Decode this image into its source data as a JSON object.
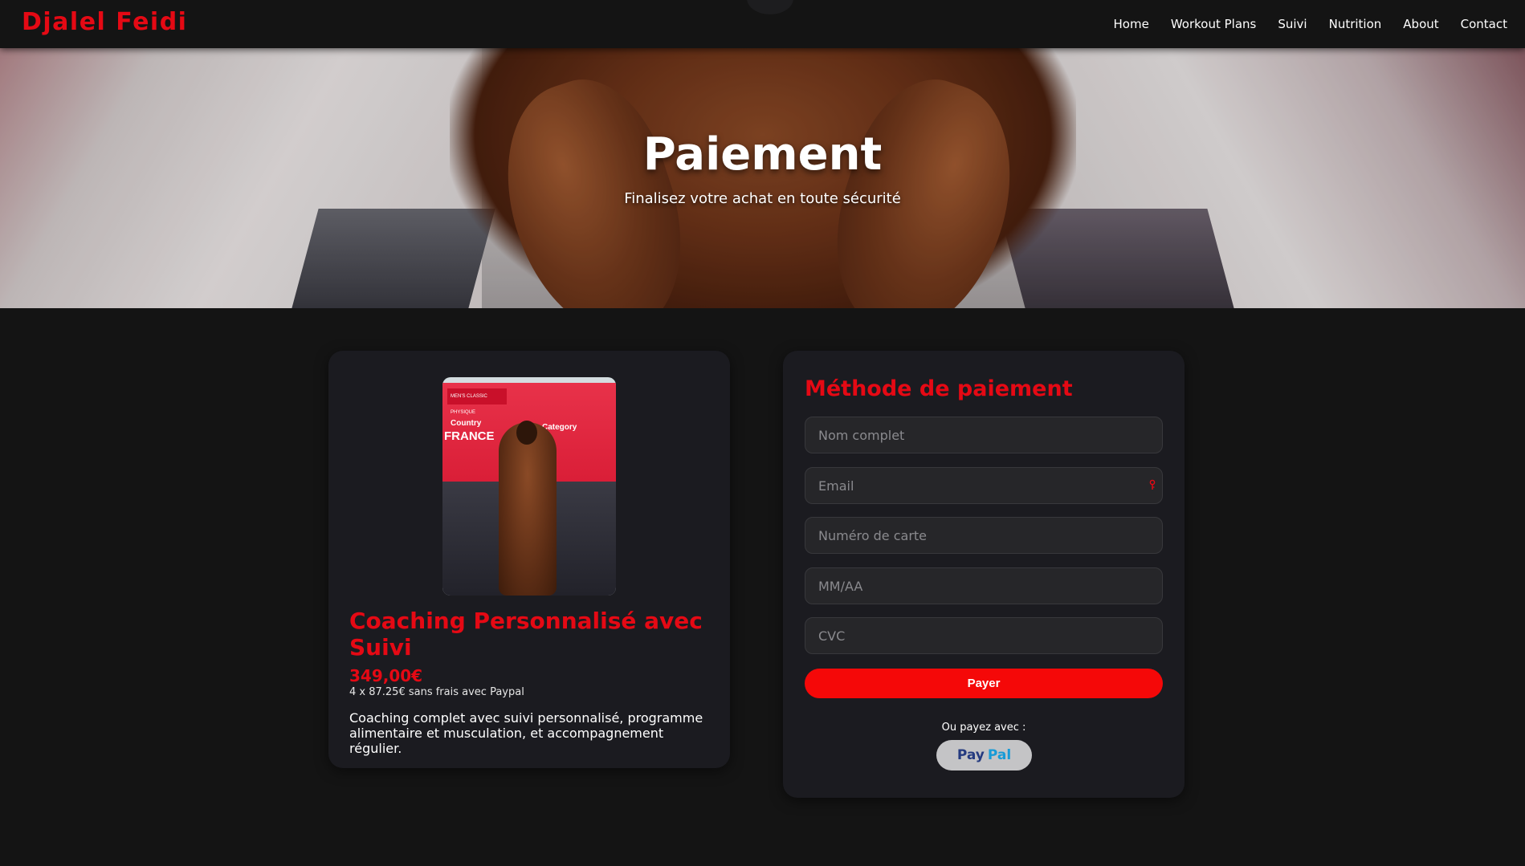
{
  "navbar": {
    "brand": "Djalel Feidi",
    "links": [
      "Home",
      "Workout Plans",
      "Suivi",
      "Nutrition",
      "About",
      "Contact"
    ]
  },
  "hero": {
    "title": "Paiement",
    "subtitle": "Finalisez votre achat en toute sécurité"
  },
  "product": {
    "image_text": {
      "tag": "MEN'S CLASSIC PHYSIQUE",
      "country_label": "Country",
      "country": "FRANCE",
      "category_label": "Category"
    },
    "title": "Coaching Personnalisé avec Suivi",
    "price": "349,00€",
    "installments": "4 x 87.25€ sans frais avec Paypal",
    "description": "Coaching complet avec suivi personnalisé, programme alimentaire et musculation, et accompagnement régulier."
  },
  "payment": {
    "title": "Méthode de paiement",
    "fields": {
      "name_placeholder": "Nom complet",
      "email_placeholder": "Email",
      "card_placeholder": "Numéro de carte",
      "expiry_placeholder": "MM/AA",
      "cvc_placeholder": "CVC"
    },
    "pay_label": "Payer",
    "alt_label": "Ou payez avec :",
    "paypal": {
      "pay": "Pay",
      "pal": "Pal"
    }
  },
  "colors": {
    "accent": "#e50914",
    "button": "#f50808",
    "background": "#141414",
    "card": "#1b1b20"
  },
  "icons": {
    "email_field": "key-icon"
  }
}
